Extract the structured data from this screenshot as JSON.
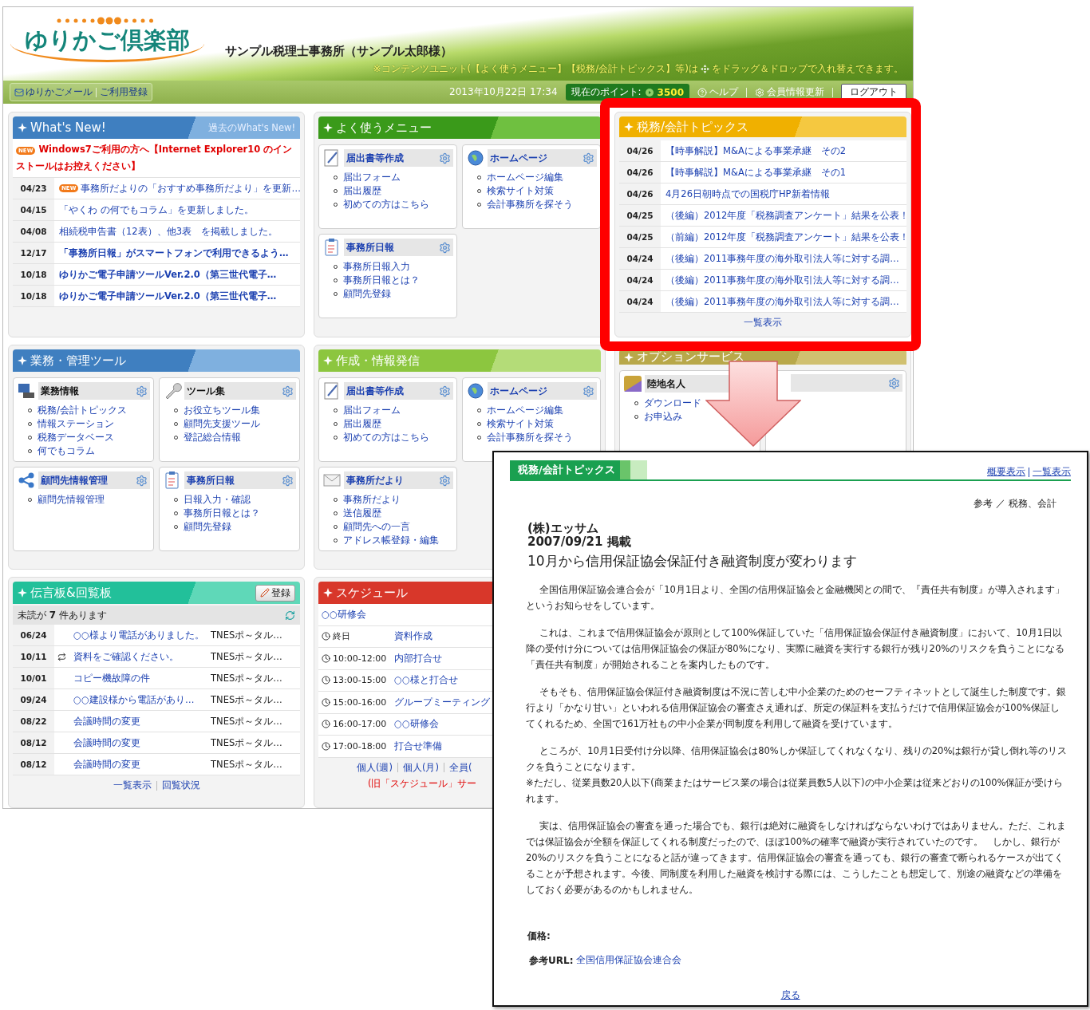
{
  "header": {
    "logo": "ゆりかご倶楽部",
    "office": "サンプル税理士事務所（サンプル太郎様）",
    "notice_before": "※コンテンツユニット(【よく使うメニュー】【税務/会計トピックス】等)は",
    "notice_after": "をドラッグ＆ドロップで入れ替えできます。"
  },
  "nav": {
    "links": [
      "ゆりかごメール",
      "ご利用登録"
    ],
    "datetime": "2013年10月22日 17:34",
    "points_label": "現在のポイント:",
    "points": "3500",
    "help": "ヘルプ",
    "member_update": "会員情報更新",
    "logout": "ログアウト"
  },
  "whats_new": {
    "title": "What's New!",
    "past_link": "過去のWhat's New!",
    "notice": {
      "badge": "NEW",
      "text": "Windows7ご利用の方へ【Internet Explorer10 のインストールはお控えください】"
    },
    "rows": [
      {
        "date": "04/23",
        "badge": "NEW",
        "bold": false,
        "text": "事務所だよりの「おすすめ事務所だより」を更新…"
      },
      {
        "date": "04/15",
        "bold": false,
        "text": "「やくわ の何でもコラム」を更新しました。"
      },
      {
        "date": "04/08",
        "bold": false,
        "text": "相続税申告書（12表）、他3表　を掲載しました。"
      },
      {
        "date": "12/17",
        "bold": true,
        "text": "「事務所日報」がスマートフォンで利用できるよう…"
      },
      {
        "date": "10/18",
        "bold": true,
        "text": "ゆりかご電子申請ツールVer.2.0（第三世代電子…"
      },
      {
        "date": "10/18",
        "bold": true,
        "text": "ゆりかご電子申請ツールVer.2.0（第三世代電子…"
      }
    ]
  },
  "tools": {
    "title": "業務・管理ツール",
    "cards": [
      {
        "kind": "monitor",
        "title": "業務情報",
        "linked": false,
        "items": [
          "税務/会計トピックス",
          "情報ステーション",
          "税務データベース",
          "何でもコラム"
        ]
      },
      {
        "kind": "wrench",
        "title": "ツール集",
        "linked": false,
        "items": [
          "お役立ちツール集",
          "顧問先支援ツール",
          "登記総合情報"
        ]
      },
      {
        "kind": "share",
        "title": "顧問先情報管理",
        "linked": true,
        "items": [
          "顧問先情報管理"
        ]
      },
      {
        "kind": "clipboard",
        "title": "事務所日報",
        "linked": true,
        "items": [
          "日報入力・確認",
          "事務所日報とは？",
          "顧問先登録"
        ]
      }
    ]
  },
  "board": {
    "title": "伝言板&回覧板",
    "register_button": "登録",
    "unread": "未読が **7** 件あります",
    "rows": [
      {
        "date": "06/24",
        "forwarded": false,
        "subject": "○○様より電話がありました。",
        "sender": "TNESポ～タル…"
      },
      {
        "date": "10/11",
        "forwarded": true,
        "subject": "資料をご確認ください。",
        "sender": "TNESポ～タル…"
      },
      {
        "date": "10/01",
        "forwarded": false,
        "subject": "コピー機故障の件",
        "sender": "TNESポ～タル…"
      },
      {
        "date": "09/24",
        "forwarded": false,
        "subject": "○○建設様から電話があり…",
        "sender": "TNESポ～タル…"
      },
      {
        "date": "08/22",
        "forwarded": false,
        "subject": "会議時間の変更",
        "sender": "TNESポ～タル…"
      },
      {
        "date": "08/12",
        "forwarded": false,
        "subject": "会議時間の変更",
        "sender": "TNESポ～タル…"
      },
      {
        "date": "08/12",
        "forwarded": false,
        "subject": "会議時間の変更",
        "sender": "TNESポ～タル…"
      }
    ],
    "links": [
      "一覧表示",
      "回覧状況"
    ]
  },
  "menu": {
    "title": "よく使うメニュー",
    "cards": [
      {
        "kind": "pen",
        "title": "届出書等作成",
        "linked": true,
        "items": [
          "届出フォーム",
          "届出履歴",
          "初めての方はこちら"
        ]
      },
      {
        "kind": "globe",
        "title": "ホームページ",
        "linked": true,
        "items": [
          "ホームページ編集",
          "検索サイト対策",
          "会計事務所を探そう"
        ]
      },
      {
        "kind": "clipboard",
        "title": "事務所日報",
        "linked": true,
        "items": [
          "事務所日報入力",
          "事務所日報とは？",
          "顧問先登録"
        ]
      }
    ]
  },
  "publish": {
    "title": "作成・情報発信",
    "cards": [
      {
        "kind": "pen",
        "title": "届出書等作成",
        "linked": true,
        "items": [
          "届出フォーム",
          "届出履歴",
          "初めての方はこちら"
        ]
      },
      {
        "kind": "globe",
        "title": "ホームページ",
        "linked": true,
        "items": [
          "ホームページ編集",
          "検索サイト対策",
          "会計事務所を探そう"
        ]
      },
      {
        "kind": "envelope",
        "title": "事務所だより",
        "linked": true,
        "items": [
          "事務所だより",
          "送信履歴",
          "顧問先への一言",
          "アドレス帳登録・編集"
        ]
      }
    ]
  },
  "schedule": {
    "title": "スケジュール",
    "event": "○○研修会",
    "rows": [
      {
        "time": "終日",
        "title": "資料作成"
      },
      {
        "time": "10:00-12:00",
        "title": "内部打合せ"
      },
      {
        "time": "13:00-15:00",
        "title": "○○様と打合せ"
      },
      {
        "time": "15:00-16:00",
        "title": "グループミーティング"
      },
      {
        "time": "16:00-17:00",
        "title": "○○研修会"
      },
      {
        "time": "17:00-18:00",
        "title": "打合せ準備"
      }
    ],
    "links": [
      "個人(週)",
      "個人(月)",
      "全員("
    ],
    "note": "(旧「スケジュール」サー"
  },
  "topics": {
    "title": "税務/会計トピックス",
    "rows": [
      {
        "date": "04/26",
        "text": "【時事解説】M&Aによる事業承継　その2"
      },
      {
        "date": "04/26",
        "text": "【時事解説】M&Aによる事業承継　その1"
      },
      {
        "date": "04/26",
        "text": "4月26日朝時点での国税庁HP新着情報"
      },
      {
        "date": "04/25",
        "text": "（後編）2012年度「税務調査アンケート」結果を公表！"
      },
      {
        "date": "04/25",
        "text": "（前編）2012年度「税務調査アンケート」結果を公表！"
      },
      {
        "date": "04/24",
        "text": "（後編）2011事務年度の海外取引法人等に対する調…"
      },
      {
        "date": "04/24",
        "text": "（後編）2011事務年度の海外取引法人等に対する調…"
      },
      {
        "date": "04/24",
        "text": "（後編）2011事務年度の海外取引法人等に対する調…"
      }
    ],
    "more": "一覧表示"
  },
  "options": {
    "title": "オプションサービス",
    "cards": [
      {
        "kind": "badge",
        "title": "陸地名人",
        "linked": false,
        "items": [
          "ダウンロード",
          "お申込み"
        ]
      }
    ]
  },
  "popup": {
    "section": "税務/会計トピックス",
    "links": [
      "概要表示",
      "一覧表示"
    ],
    "category": "参考 ／ 税務、会計",
    "company": "(株)エッサム",
    "posted": "2007/09/21 掲載",
    "headline": "10月から信用保証協会保証付き融資制度が変わります",
    "paragraphs": [
      "全国信用保証協会連合会が「10月1日より、全国の信用保証協会と金融機関との間で、『責任共有制度』が導入されます」というお知らせをしています。",
      "これは、これまで信用保証協会が原則として100%保証していた「信用保証協会保証付き融資制度」において、10月1日以降の受付け分については信用保証協会の保証が80%になり、実際に融資を実行する銀行が残り20%のリスクを負うことになる「責任共有制度」が開始されることを案内したものです。",
      "そもそも、信用保証協会保証付き融資制度は不況に苦しむ中小企業のためのセーフティネットとして誕生した制度です。銀行より「かなり甘い」といわれる信用保証協会の審査さえ通れば、所定の保証料を支払うだけで信用保証協会が100%保証してくれるため、全国で161万社もの中小企業が同制度を利用して融資を受けています。",
      "ところが、10月1日受付け分以降、信用保証協会は80%しか保証してくれなくなり、残りの20%は銀行が貸し倒れ等のリスクを負うことになります。\n※ただし、従業員数20人以下(商業またはサービス業の場合は従業員数5人以下)の中小企業は従来どおりの100%保証が受けられます。",
      "実は、信用保証協会の審査を通った場合でも、銀行は絶対に融資をしなければならないわけではありません。ただ、これまでは保証協会が全額を保証してくれる制度だったので、ほぼ100%の確率で融資が実行されていたのです。　しかし、銀行が20%のリスクを負うことになると話が違ってきます。信用保証協会の審査を通っても、銀行の審査で断られるケースが出てくることが予想されます。今後、同制度を利用した融資を検討する際には、こうしたことも想定して、別途の融資などの準備をしておく必要があるのかもしれません。"
    ],
    "price_label": "価格:",
    "url_label": "参考URL:",
    "url_link": "全国信用保証協会連合会",
    "back": "戻る"
  }
}
